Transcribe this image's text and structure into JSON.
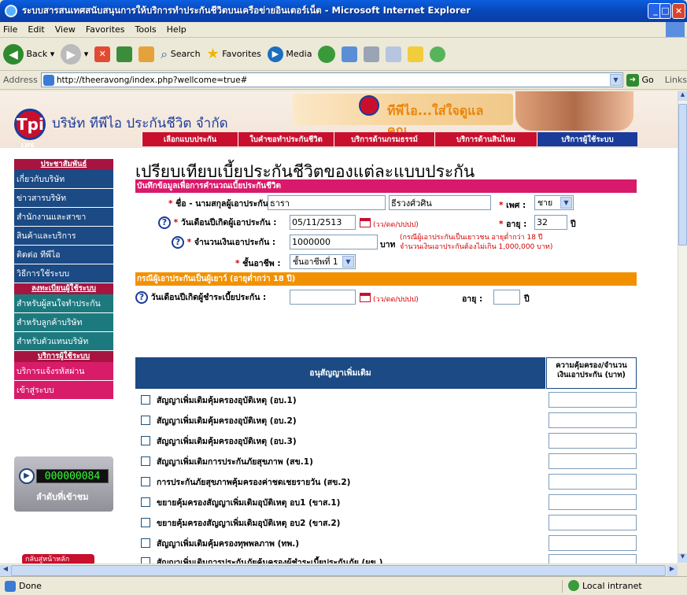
{
  "window": {
    "title": "ระบบสารสนเทศสนับสนุนการให้บริการทำประกันชีวิตบนเครือข่ายอินเตอร์เน็ต - Microsoft Internet Explorer"
  },
  "menu": [
    "File",
    "Edit",
    "View",
    "Favorites",
    "Tools",
    "Help"
  ],
  "toolbar": {
    "back": "Back",
    "search": "Search",
    "favorites": "Favorites",
    "media": "Media"
  },
  "address": {
    "label": "Address",
    "url": "http://theeravong/index.php?wellcome=true#",
    "go": "Go",
    "links": "Links"
  },
  "header": {
    "logo_text": "Tpi",
    "logo_sub": "LIFE",
    "company": "บริษัท ทีพีไอ ประกันชีวิต จำกัด",
    "slogan": "ทีพีไอ...ใส่ใจดูแลคุณ...",
    "nav": [
      "เลือกแบบประกัน",
      "ใบคำขอทำประกันชีวิต",
      "บริการด้านกรมธรรม์",
      "บริการด้านสินไหม",
      "บริการผู้ใช้ระบบ"
    ]
  },
  "sidebar": {
    "head1": "ประชาสัมพันธ์",
    "group1": [
      "เกี่ยวกับบริษัท",
      "ข่าวสารบริษัท",
      "สำนักงานและสาขา",
      "สินค้าและบริการ",
      "ติดต่อ ทีพีไอ",
      "วิธีการใช้ระบบ"
    ],
    "head2": "ลงทะเบียนผู้ใช้ระบบ",
    "group2": [
      "สำหรับผู้สนใจทำประกัน",
      "สำหรับลูกค้าบริษัท",
      "สำหรับตัวแทนบริษัท"
    ],
    "head3": "บริการผู้ใช้ระบบ",
    "group3": [
      "บริการแจ้งรหัสผ่าน",
      "เข้าสู่ระบบ"
    ],
    "counter": "000000084",
    "counter_label": "ลำดับที่เข้าชม",
    "back_button": "กลับสู่หน้าหลัก"
  },
  "page": {
    "title": "เปรียบเทียบเบี้ยประกันชีวิตของแต่ละแบบประกัน"
  },
  "form": {
    "section1": "บันทึกข้อมูลเพื่อการคำนวณเบี้ยประกันชีวิต",
    "name_label": "ชื่อ - นามสกุลผู้เอาประกัน :",
    "first_name": "ธารา",
    "last_name": "ธีรวงศ์วศิน",
    "sex_label": "เพศ :",
    "sex_value": "ชาย",
    "dob_label": "วันเดือนปีเกิดผู้เอาประกัน :",
    "dob_value": "05/11/2513",
    "date_hint": "(วว/ดด/ปปปป)",
    "age_label": "อายุ :",
    "age_value": "32",
    "age_unit": "ปี",
    "amount_label": "จำนวนเงินเอาประกัน :",
    "amount_value": "1000000",
    "amount_unit": "บาท",
    "amount_hint1": "(กรณีผู้เอาประกันเป็นเยาวชน อายุต่ำกว่า 18 ปี",
    "amount_hint2": "จำนวนเงินเอาประกันต้องไม่เกิน 1,000,000 บาท)",
    "occ_label": "ชั้นอาชีพ :",
    "occ_value": "ชั้นอาชีพที่ 1",
    "section2": "กรณีผู้เอาประกันเป็นผู้เยาว์ (อายุต่ำกว่า 18 ปี)",
    "payer_dob_label": "วันเดือนปีเกิดผู้ชำระเบี้ยประกัน :",
    "payer_age_label": "อายุ :",
    "payer_age_unit": "ปี"
  },
  "riders": {
    "col1": "อนุสัญญาเพิ่มเติม",
    "col2_line1": "ความคุ้มครอง/จำนวน",
    "col2_line2": "เงินเอาประกัน (บาท)",
    "items": [
      "สัญญาเพิ่มเติมคุ้มครองอุบัติเหตุ (อบ.1)",
      "สัญญาเพิ่มเติมคุ้มครองอุบัติเหตุ (อบ.2)",
      "สัญญาเพิ่มเติมคุ้มครองอุบัติเหตุ (อบ.3)",
      "สัญญาเพิ่มเติมการประกันภัยสุขภาพ (สข.1)",
      "การประกันภัยสุขภาพคุ้มครองค่าชดเชยรายวัน (สข.2)",
      "ขยายคุ้มครองสัญญาเพิ่มเติมอุบัติเหตุ อบ1 (ขาส.1)",
      "ขยายคุ้มครองสัญญาเพิ่มเติมอุบัติเหตุ อบ2 (ขาส.2)",
      "สัญญาเพิ่มเติมคุ้มครองทุพพลภาพ (ทพ.)",
      "สัญญาเพิ่มเติมการประกันภัยคุ้มครองผู้ชำระเบี้ยประกันภัย (ผข.)"
    ]
  },
  "status": {
    "left": "Done",
    "right": "Local intranet"
  },
  "colors": {
    "nav": "#c8102e",
    "sidebar": "#1b4a84",
    "section": "#d9196b",
    "section2": "#f29100"
  }
}
